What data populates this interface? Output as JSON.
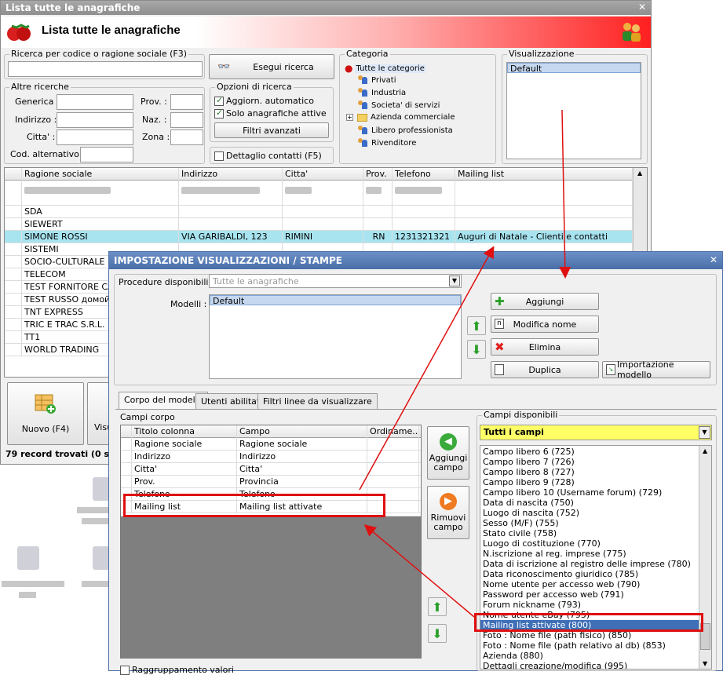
{
  "main_window": {
    "title": "Lista tutte le anagrafiche",
    "header_title": "Lista tutte le anagrafiche",
    "search_group_label": "Ricerca per codice o ragione sociale (F3)",
    "search_button": "Esegui ricerca",
    "other_search_label": "Altre ricerche",
    "fields": {
      "generica": "Generica :",
      "prov": "Prov. :",
      "indirizzo": "Indirizzo :",
      "naz": "Naz. :",
      "citta": "Citta' :",
      "zona": "Zona :",
      "cod_alt": "Cod. alternativo :"
    },
    "options_label": "Opzioni di ricerca",
    "opt_auto": "Aggiorn. automatico",
    "opt_active": "Solo anagrafiche attive",
    "advanced_filters": "Filtri avanzati",
    "contact_detail": "Dettaglio contatti (F5)",
    "category_label": "Categoria",
    "categories": [
      "Tutte le categorie",
      "Privati",
      "Industria",
      "Societa' di servizi",
      "Azienda commerciale",
      "Libero professionista",
      "Rivenditore"
    ],
    "view_label": "Visualizzazione",
    "view_items": [
      "Default"
    ],
    "columns": [
      "Ragione sociale",
      "Indirizzo",
      "Citta'",
      "Prov.",
      "Telefono",
      "Mailing list"
    ],
    "rows": [
      {
        "name": "SDA",
        "addr": "",
        "city": "",
        "prov": "",
        "tel": "",
        "ml": ""
      },
      {
        "name": "SIEWERT",
        "addr": "",
        "city": "",
        "prov": "",
        "tel": "",
        "ml": ""
      },
      {
        "name": "SIMONE ROSSI",
        "addr": "VIA GARIBALDI, 123",
        "city": "RIMINI",
        "prov": "RN",
        "tel": "1231321321",
        "ml": "Auguri di Natale - Clienti e contatti"
      },
      {
        "name": "SISTEMI",
        "addr": "",
        "city": "",
        "prov": "",
        "tel": "",
        "ml": ""
      },
      {
        "name": "SOCIO-CULTURALE",
        "addr": "",
        "city": "",
        "prov": "",
        "tel": "",
        "ml": ""
      },
      {
        "name": "TELECOM",
        "addr": "",
        "city": "",
        "prov": "",
        "tel": "",
        "ml": ""
      },
      {
        "name": "TEST FORNITORE CAT",
        "addr": "",
        "city": "",
        "prov": "",
        "tel": "",
        "ml": ""
      },
      {
        "name": "TEST RUSSO домой",
        "addr": "",
        "city": "",
        "prov": "",
        "tel": "",
        "ml": ""
      },
      {
        "name": "TNT EXPRESS",
        "addr": "",
        "city": "",
        "prov": "",
        "tel": "",
        "ml": ""
      },
      {
        "name": "TRIC E TRAC S.R.L.",
        "addr": "",
        "city": "",
        "prov": "",
        "tel": "",
        "ml": ""
      },
      {
        "name": "TT1",
        "addr": "",
        "city": "",
        "prov": "",
        "tel": "",
        "ml": ""
      },
      {
        "name": "WORLD TRADING",
        "addr": "",
        "city": "",
        "prov": "",
        "tel": "",
        "ml": ""
      }
    ],
    "new_button": "Nuovo (F4)",
    "view_button_partial": "Visu",
    "record_count": "79 record trovati (0 sec"
  },
  "dialog": {
    "title": "IMPOSTAZIONE VISUALIZZAZIONI / STAMPE",
    "procedures_label": "Procedure disponibili :",
    "procedures_value": "Tutte le anagrafiche",
    "models_label": "Modelli :",
    "models": [
      "Default"
    ],
    "btn_add": "Aggiungi",
    "btn_rename": "Modifica nome",
    "btn_delete": "Elimina",
    "btn_duplicate": "Duplica",
    "btn_import": "Importazione modello",
    "tabs": [
      "Corpo del modello",
      "Utenti abilitati",
      "Filtri linee da visualizzare"
    ],
    "body_fields_label": "Campi corpo",
    "body_columns": [
      "Titolo colonna",
      "Campo",
      "Ordiname..."
    ],
    "body_rows": [
      {
        "title": "Ragione sociale",
        "field": "Ragione sociale"
      },
      {
        "title": "Indirizzo",
        "field": "Indirizzo"
      },
      {
        "title": "Citta'",
        "field": "Citta'"
      },
      {
        "title": "Prov.",
        "field": "Provincia"
      },
      {
        "title": "Telefono",
        "field": "Telefono"
      },
      {
        "title": "Mailing list",
        "field": "Mailing list attivate"
      }
    ],
    "btn_add_field": "Aggiungi campo",
    "btn_remove_field": "Rimuovi campo",
    "grouping_label": "Raggruppamento valori",
    "available_label": "Campi disponibili",
    "available_filter": "Tutti i campi",
    "available_fields": [
      "Campo libero 6 (725)",
      "Campo libero 7 (726)",
      "Campo libero 8 (727)",
      "Campo libero 9 (728)",
      "Campo libero 10 (Username forum) (729)",
      "Data di nascita (750)",
      "Luogo di nascita (752)",
      "Sesso (M/F) (755)",
      "Stato civile (758)",
      "Luogo di costituzione (770)",
      "N.iscrizione al reg. imprese (775)",
      "Data di iscrizione al registro delle imprese (780)",
      "Data riconoscimento giuridico (785)",
      "Nome utente per accesso web (790)",
      "Password per accesso web (791)",
      "Forum nickname (793)",
      "Nome utente eBay (795)",
      "Mailing list attivate (800)",
      "Foto : Nome file (path fisico) (850)",
      "Foto : Nome file (path relativo al db) (853)",
      "Azienda (880)",
      "Dettagli creazione/modifica (995)"
    ]
  },
  "colors": {
    "highlight_row": "#a8e4f0",
    "accent_red": "#e01010",
    "filter_yellow": "#ffff66"
  }
}
